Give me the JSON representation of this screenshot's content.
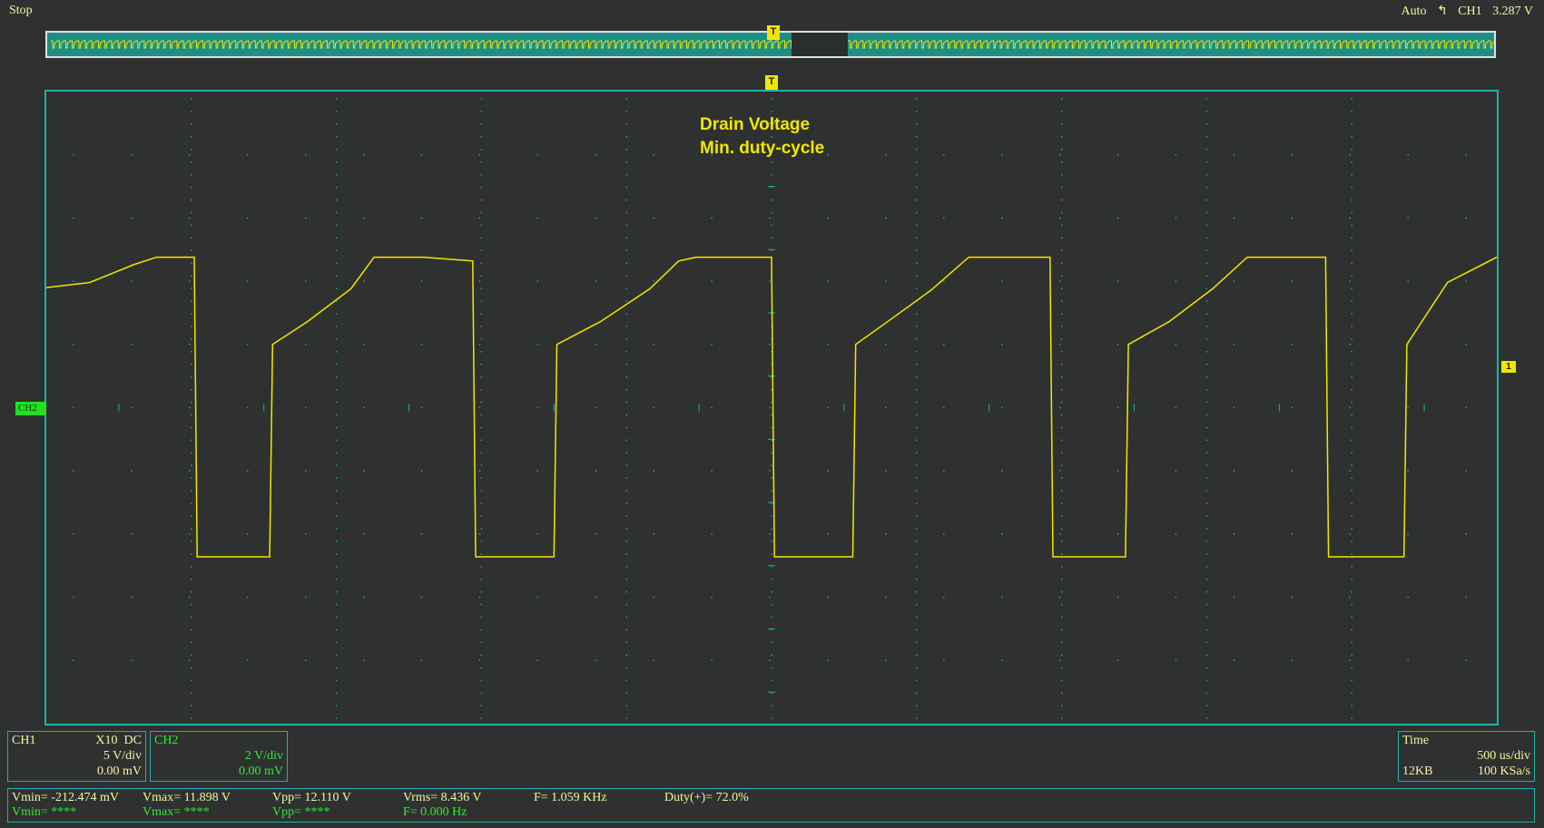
{
  "status": {
    "run_state": "Stop",
    "trigger_mode": "Auto",
    "trigger_source": "CH1",
    "trigger_level": "3.287 V",
    "trigger_marker": "T"
  },
  "annotations": {
    "line1": "Drain Voltage",
    "line2": "Min. duty-cycle"
  },
  "markers": {
    "ch2": "CH2",
    "ch1_level": "1"
  },
  "channels": {
    "ch1": {
      "name": "CH1",
      "probe": "X10",
      "coupling": "DC",
      "scale": "5 V/div",
      "offset": "0.00 mV"
    },
    "ch2": {
      "name": "CH2",
      "scale": "2 V/div",
      "offset": "0.00 mV"
    }
  },
  "timebase": {
    "label": "Time",
    "scale": "500 us/div",
    "memory": "12KB",
    "sample_rate": "100 KSa/s"
  },
  "measurements": {
    "ch1": {
      "vmin": "Vmin= -212.474 mV",
      "vmax": "Vmax= 11.898 V",
      "vpp": "Vpp= 12.110 V",
      "vrms": "Vrms= 8.436 V",
      "freq": "F= 1.059 KHz",
      "duty": "Duty(+)= 72.0%"
    },
    "ch2": {
      "vmin": "Vmin= ****",
      "vmax": "Vmax= ****",
      "vpp": "Vpp= ****",
      "freq": "F= 0.000 Hz"
    }
  },
  "colors": {
    "ch1": "#f2e600",
    "ch2": "#22e022",
    "grid": "#1fb1a5",
    "background": "#2f3131"
  },
  "chart_data": {
    "type": "line",
    "x_unit": "ms",
    "y_unit": "V",
    "xlim": [
      -2.5,
      2.5
    ],
    "ylim": [
      -25,
      25
    ],
    "grid_divisions": {
      "x": 10,
      "y": 10
    },
    "series": [
      {
        "name": "CH1",
        "x": [
          -2.5,
          -2.35,
          -2.2,
          -2.12,
          -1.99,
          -1.98,
          -1.86,
          -1.73,
          -1.72,
          -1.6,
          -1.45,
          -1.37,
          -1.2,
          -1.03,
          -1.02,
          -0.88,
          -0.75,
          -0.74,
          -0.59,
          -0.42,
          -0.32,
          -0.26,
          -0.07,
          0.0,
          0.01,
          0.15,
          0.28,
          0.29,
          0.4,
          0.55,
          0.68,
          0.86,
          0.96,
          0.97,
          1.09,
          1.22,
          1.23,
          1.37,
          1.52,
          1.64,
          1.85,
          1.91,
          1.92,
          2.04,
          2.18,
          2.19,
          2.33,
          2.5
        ],
        "y": [
          9.5,
          9.9,
          11.3,
          11.9,
          11.9,
          -11.8,
          -11.8,
          -11.8,
          5.0,
          6.8,
          9.4,
          11.9,
          11.9,
          11.6,
          -11.8,
          -11.8,
          -11.8,
          5.0,
          6.8,
          9.4,
          11.6,
          11.9,
          11.9,
          11.9,
          -11.8,
          -11.8,
          -11.8,
          5.0,
          6.8,
          9.3,
          11.9,
          11.9,
          11.9,
          -11.8,
          -11.8,
          -11.8,
          5.0,
          6.8,
          9.4,
          11.9,
          11.9,
          11.9,
          -11.8,
          -11.8,
          -11.8,
          5.0,
          9.9,
          11.9
        ]
      }
    ]
  }
}
